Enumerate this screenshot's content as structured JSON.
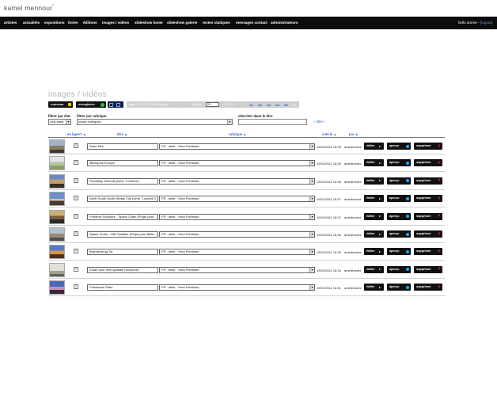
{
  "brand": {
    "name": "kamel mennour",
    "mark": "*"
  },
  "nav": {
    "items": [
      "artistes",
      "actualités",
      "expositions",
      "foires",
      "éditions",
      "images / vidéos",
      "slideshow home",
      "slideshow galerie",
      "textes statiques",
      "messages contact",
      "administrateurs"
    ],
    "user_prefix": "hello dorme -",
    "logout": "[logout]"
  },
  "page": {
    "title": "images / vidéos"
  },
  "toolbar": {
    "new_label": "nouveau",
    "save_label": "enregistrer",
    "pager_text": "page 1 / 197 (3702 éléments)",
    "per_page_label": "afficher",
    "per_page_value": "20",
    "page_sep": "<< 1 2 3 ...",
    "pages": [
      "A1",
      "A2",
      "A3",
      "A4",
      "B1"
    ],
    "next": ">>",
    "last": ">>>"
  },
  "filters": {
    "state_label": "filtrer par état",
    "state_value": "tous états",
    "rubric_label": "filtrer par rubrique",
    "rubric_value": "toutes rubriques",
    "search_label": "chercher dans le titre",
    "search_value": "",
    "submit": "» filtrer"
  },
  "columns": {
    "online": "en ligne? ▲",
    "title": "titre ▲",
    "rubric": "rubrique ▲",
    "created": "créé le ▲",
    "by": "par ▲"
  },
  "row_buttons": {
    "edit": "éditer",
    "preview": "aperçu",
    "delete": "supprimer"
  },
  "colors": {
    "accent": "#3a62d8",
    "nav_bg": "#0c0c0c",
    "button_bg": "#111111"
  },
  "rows": [
    {
      "title": "Sans Titre",
      "rubric": "FR : artist : Yona Friedman",
      "date": "19/01/2011 16:39",
      "author": "amelienoshi",
      "online": true
    },
    {
      "title": "Métropole Europe",
      "rubric": "FR : artist : Yona Friedman",
      "date": "19/01/2011 16:39",
      "author": "amelienoshi",
      "online": true
    },
    {
      "title": "Piccadilly Onboulli (série \"Londres\")",
      "rubric": "FR : artist : Yona Friedman",
      "date": "19/01/2011 16:38",
      "author": "amelienoshi",
      "online": true
    },
    {
      "title": "North South North Bridge City (série \"Londres\")",
      "rubric": "FR : artist : Yona Friedman",
      "date": "19/01/2011 16:37",
      "author": "amelienoshi",
      "online": true
    },
    {
      "title": "Protéinic Structure - Space Chain (Projet pour ...",
      "rubric": "FR : artist : Yona Friedman",
      "date": "19/01/2011 16:37",
      "author": "amelienoshi",
      "online": true
    },
    {
      "title": "Space Chain - Ville Spatiale (Projet pour Bâtin ...",
      "rubric": "FR : artist : Yona Friedman",
      "date": "19/01/2011 16:36",
      "author": "amelienoshi",
      "online": true
    },
    {
      "title": "Brandenburg Tor",
      "rubric": "FR : artist : Yona Friedman",
      "date": "19/01/2011 16:35",
      "author": "amelienoshi",
      "online": true
    },
    {
      "title": "Etude pour Ville spatiale (structure)",
      "rubric": "FR : artist : Yona Friedman",
      "date": "19/01/2011 16:34",
      "author": "amelienoshi",
      "online": true
    },
    {
      "title": "Potsdamer Platz",
      "rubric": "FR : artist : Yona Friedman",
      "date": "19/01/2011 16:31",
      "author": "amelienoshi",
      "online": true
    }
  ]
}
